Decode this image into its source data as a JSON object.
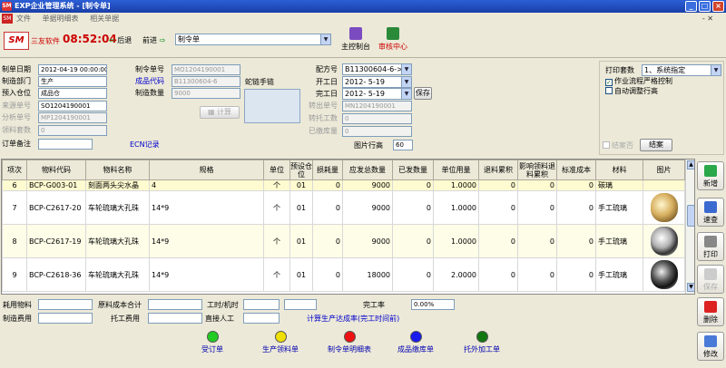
{
  "window": {
    "title": "EXP企业管理系统 - [制令单]",
    "logo_text": "SM"
  },
  "menubar": {
    "items": [
      "文件",
      "单据明细表",
      "相关单据"
    ],
    "right": "- ✕"
  },
  "toolbar": {
    "brand": "三友软件",
    "clock": "08:52:04",
    "back_label": "后退",
    "forward_label": "前进",
    "doc_select": "制令单",
    "control_label": "主控制台",
    "audit_label": "审核中心"
  },
  "form": {
    "labels": {
      "make_date": "制单日期",
      "make_dept": "制造部门",
      "pre_store": "预入仓位",
      "source_no": "来源单号",
      "split_no": "分析单号",
      "set_count": "领料套数",
      "order_note": "订单备注",
      "order_no": "制令单号",
      "product_code": "成品代码",
      "make_qty": "制造数量",
      "config_no": "配方号",
      "start_date": "开工日",
      "finish_date": "完工日",
      "transfer_no": "转出单号",
      "transfer_qty": "转托工数",
      "stored_qty": "已缴库量",
      "pic_row_height": "图片行高",
      "ecn": "ECN记录",
      "product_name": "蛇链手链"
    },
    "values": {
      "make_date": "2012-04-19 00:00:00",
      "make_dept": "生产",
      "pre_store": "成品仓",
      "source_no": "SO1204190001",
      "split_no": "MP1204190001",
      "set_count": "0",
      "order_note": "",
      "order_no": "MO1204190001",
      "product_code": "B11300604-6",
      "make_qty": "9000",
      "config_no": "B11300604-6->1",
      "start_date": "2012- 5-19",
      "finish_date": "2012- 5-19",
      "transfer_no": "MN1204190001",
      "transfer_qty": "0",
      "stored_qty": "0",
      "pic_row_height": "60"
    },
    "buttons": {
      "calc": "计算",
      "save": "保存",
      "close": "结案"
    },
    "print": {
      "label": "打印套数",
      "value": "1、系统指定",
      "opt1": "作业流程严格控制",
      "opt2": "自动调整行高",
      "cancel_check": "结案否"
    }
  },
  "table": {
    "headers": [
      "项次",
      "物料代码",
      "物料名称",
      "规格",
      "单位",
      "预设仓位",
      "损耗量",
      "应发总数量",
      "已发数量",
      "单位用量",
      "退料累积",
      "影响领料退料累积",
      "标准成本",
      "材料",
      "图片"
    ],
    "rows": [
      {
        "no": "6",
        "code": "BCP-G003-01",
        "name": "刻面两头尖水晶",
        "spec": "4",
        "unit": "个",
        "store": "01",
        "loss": "0",
        "need": "9000",
        "issued": "0",
        "usage": "1.0000",
        "returned": "0",
        "impact": "0",
        "cost": "0",
        "material": "碳璃",
        "gem": ""
      },
      {
        "no": "7",
        "code": "BCP-C2617-20",
        "name": "车轮琉璃大孔珠",
        "spec": "14*9",
        "unit": "个",
        "store": "01",
        "loss": "0",
        "need": "9000",
        "issued": "0",
        "usage": "1.0000",
        "returned": "0",
        "impact": "0",
        "cost": "0",
        "material": "手工琉璃",
        "gem": "gold-bead"
      },
      {
        "no": "8",
        "code": "BCP-C2617-19",
        "name": "车轮琉璃大孔珠",
        "spec": "14*9",
        "unit": "个",
        "store": "01",
        "loss": "0",
        "need": "9000",
        "issued": "0",
        "usage": "1.0000",
        "returned": "0",
        "impact": "0",
        "cost": "0",
        "material": "手工琉璃",
        "gem": "silver-bead"
      },
      {
        "no": "9",
        "code": "BCP-C2618-36",
        "name": "车轮琉璃大孔珠",
        "spec": "14*9",
        "unit": "个",
        "store": "01",
        "loss": "0",
        "need": "18000",
        "issued": "0",
        "usage": "2.0000",
        "returned": "0",
        "impact": "0",
        "cost": "0",
        "material": "手工琉璃",
        "gem": "dark-bead"
      }
    ]
  },
  "sidebar": {
    "add": "新增",
    "query": "速查",
    "print": "打印",
    "save": "保存",
    "delete": "删除",
    "edit": "修改"
  },
  "footer": {
    "material_cost": "耗用物料",
    "raw_total": "原料成本合计",
    "hours": "工时/机时",
    "finish_rate": "完工率",
    "finish_rate_value": "0.00%",
    "make_cost": "制造费用",
    "outsource_cost": "托工费用",
    "direct_labor": "直接人工",
    "calc_link": "计算生产达成率(完工时间前)"
  },
  "flow": [
    {
      "label": "受订单",
      "color": "#22cc22"
    },
    {
      "label": "生产领料单",
      "color": "#f0e000"
    },
    {
      "label": "制令单明细表",
      "color": "#ee1111"
    },
    {
      "label": "成品缴库单",
      "color": "#1a1aee"
    },
    {
      "label": "托外加工单",
      "color": "#117711"
    }
  ]
}
